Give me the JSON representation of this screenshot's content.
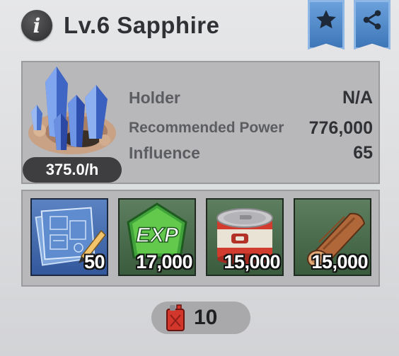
{
  "header": {
    "info_icon": "info-icon",
    "title": "Lv.6 Sapphire",
    "favorite_icon": "star-icon",
    "share_icon": "share-icon"
  },
  "resource": {
    "image": "sapphire-crystal-icon",
    "rate": "375.0/h",
    "stats": [
      {
        "label": "Holder",
        "value": "N/A"
      },
      {
        "label": "Recommended Power",
        "value": "776,000"
      },
      {
        "label": "Influence",
        "value": "65"
      }
    ]
  },
  "rewards": [
    {
      "icon": "blueprint-icon",
      "amount": "50"
    },
    {
      "icon": "exp-icon",
      "amount": "17,000"
    },
    {
      "icon": "canned-food-icon",
      "amount": "15,000"
    },
    {
      "icon": "wood-log-icon",
      "amount": "15,000"
    }
  ],
  "cost": {
    "icon": "fuel-can-icon",
    "amount": "10"
  },
  "colors": {
    "ribbon_blue": "#4a82c4",
    "panel_grey": "#b8b8ba",
    "tile_green": "#3f6a45",
    "tile_blue": "#3b63a8"
  }
}
